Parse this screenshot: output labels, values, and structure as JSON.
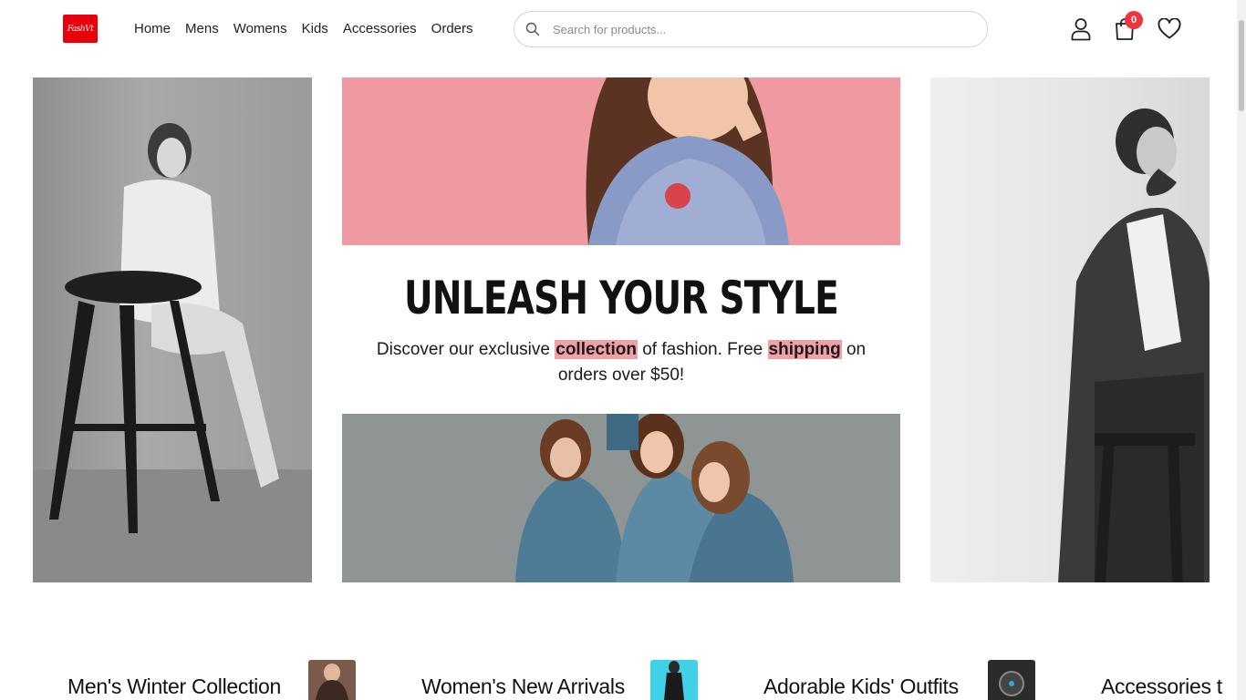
{
  "brand": {
    "logo_text": "FashVt",
    "logo_color": "#e8000b"
  },
  "nav": {
    "items": [
      {
        "label": "Home"
      },
      {
        "label": "Mens"
      },
      {
        "label": "Womens"
      },
      {
        "label": "Kids"
      },
      {
        "label": "Accessories"
      },
      {
        "label": "Orders"
      }
    ]
  },
  "search": {
    "placeholder": "Search for products...",
    "icon": "search-icon"
  },
  "header_icons": {
    "account": "user-icon",
    "cart": "shopping-bag-icon",
    "wishlist": "heart-icon"
  },
  "cart": {
    "count": "0",
    "badge_color": "#ef3340"
  },
  "hero": {
    "title": "UNLEASH YOUR STYLE",
    "subtitle_part1": "Discover our exclusive ",
    "highlight1": "collection",
    "subtitle_part2": " of fashion. Free ",
    "highlight2": "shipping",
    "subtitle_part3": " on orders over $50!",
    "highlight_color": "#f1a1a5"
  },
  "categories": [
    {
      "label": "Men's Winter Collection"
    },
    {
      "label": "Women's New Arrivals"
    },
    {
      "label": "Adorable Kids' Outfits"
    },
    {
      "label": "Accessories t"
    }
  ]
}
